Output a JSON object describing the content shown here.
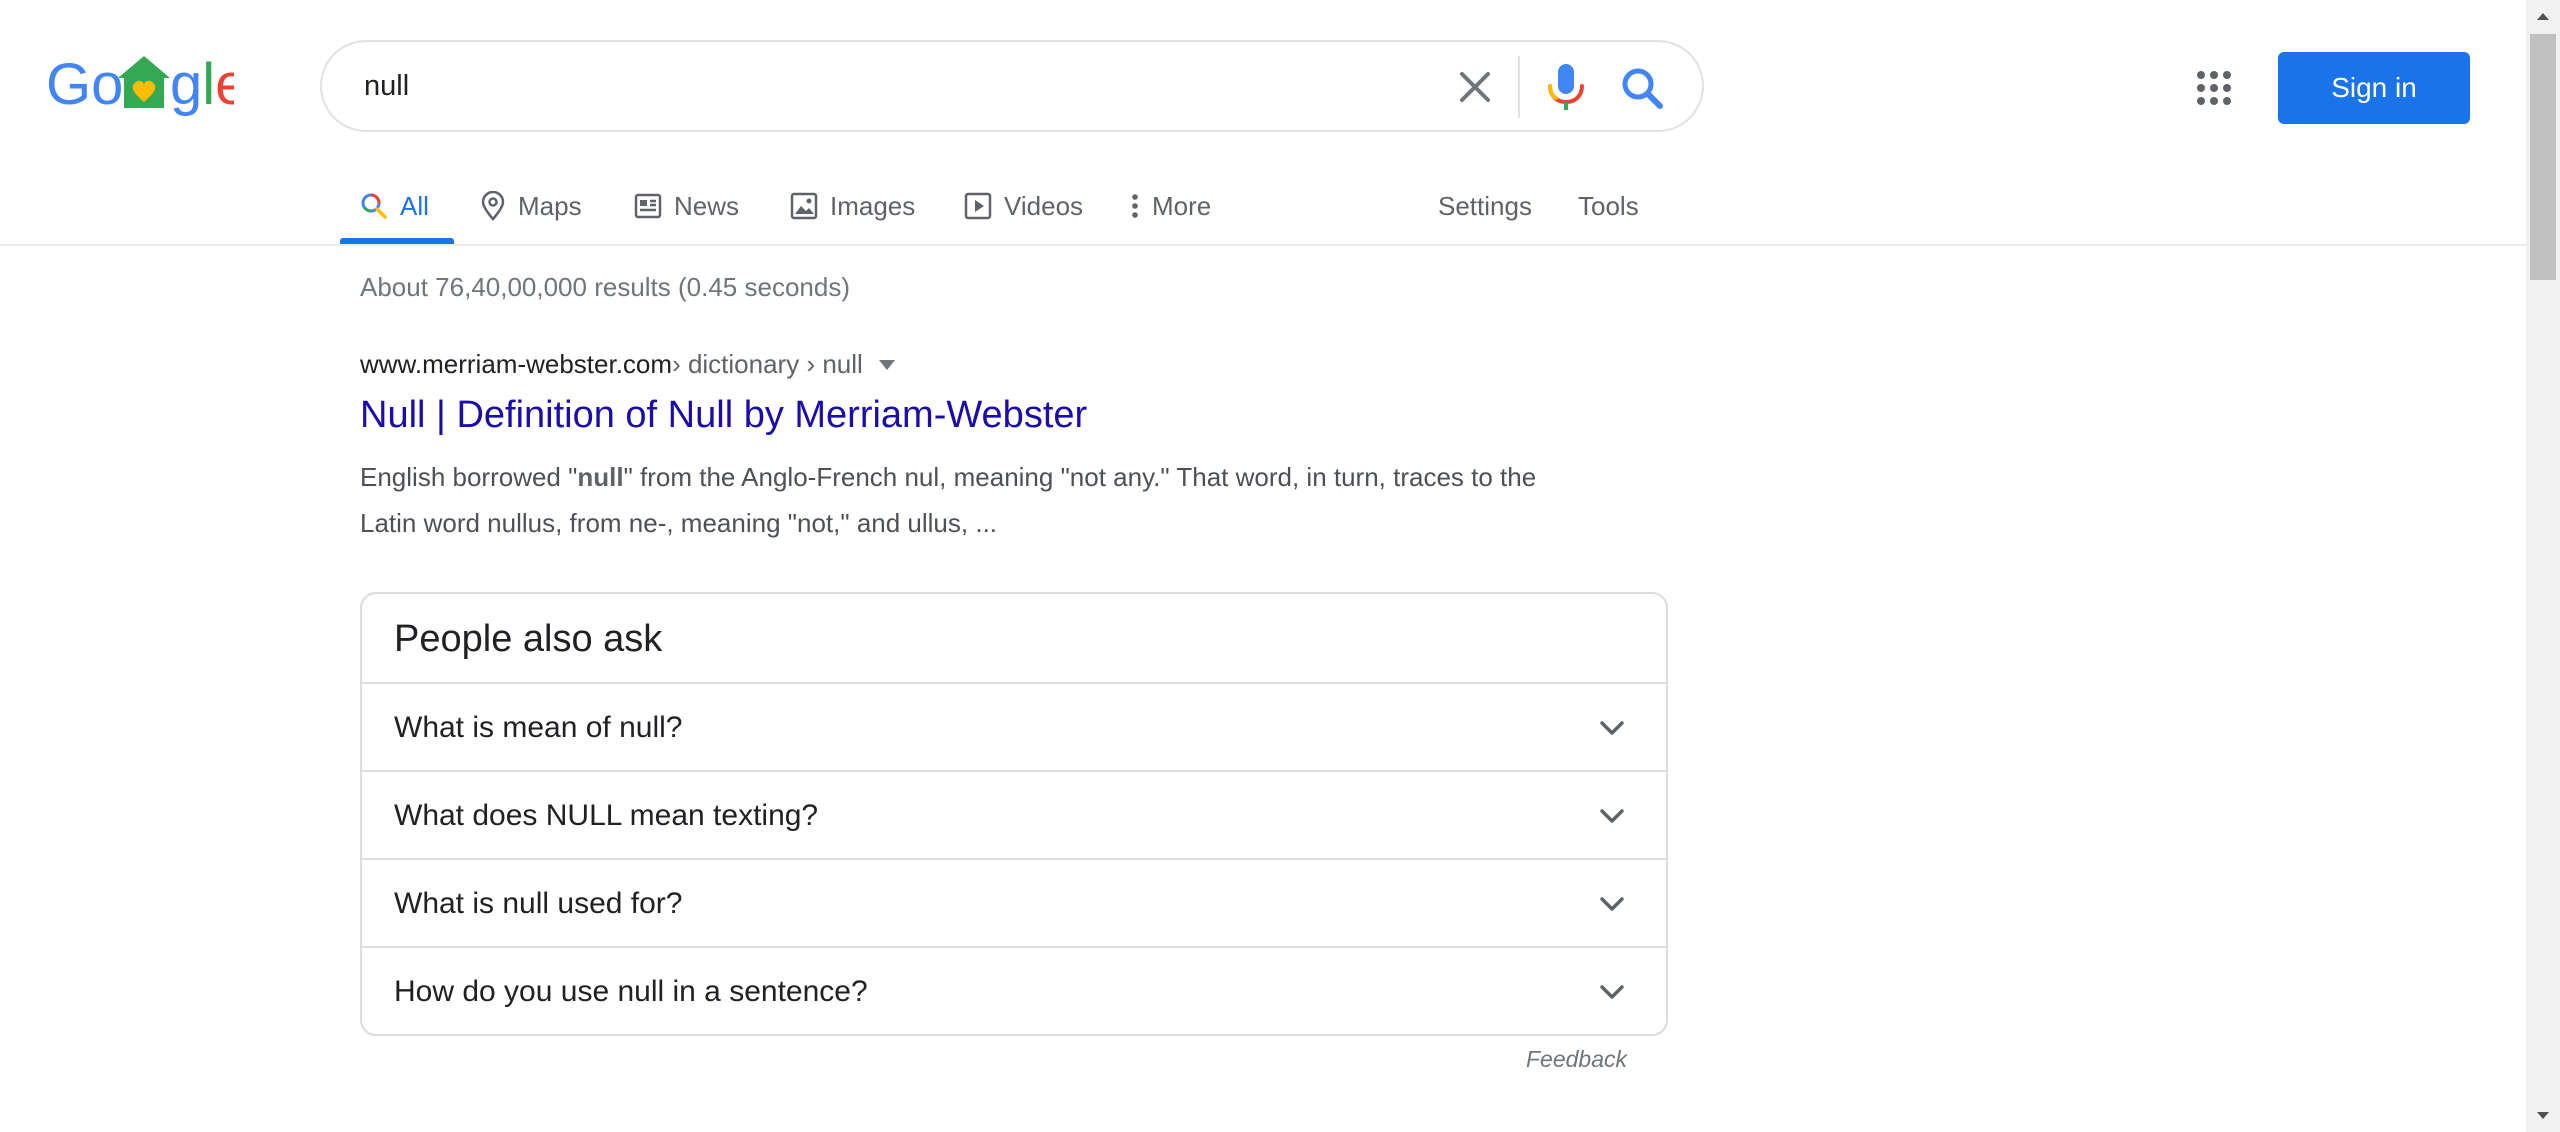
{
  "logo": {
    "text": "Google"
  },
  "search": {
    "query": "null",
    "clear_icon": "close-icon",
    "mic_icon": "microphone-icon",
    "search_icon": "search-icon"
  },
  "header": {
    "apps_icon": "apps-grid-icon",
    "signin_label": "Sign in"
  },
  "tabs": [
    {
      "label": "All",
      "icon": "search-icon",
      "active": true
    },
    {
      "label": "Maps",
      "icon": "map-pin-icon"
    },
    {
      "label": "News",
      "icon": "news-icon"
    },
    {
      "label": "Images",
      "icon": "image-icon"
    },
    {
      "label": "Videos",
      "icon": "play-icon"
    },
    {
      "label": "More",
      "icon": "more-vertical-icon"
    }
  ],
  "tools": {
    "settings": "Settings",
    "tools": "Tools"
  },
  "result_stats": "About 76,40,00,000 results (0.45 seconds)",
  "result": {
    "site": "www.merriam-webster.com",
    "breadcrumb": " › dictionary › null",
    "title": "Null | Definition of Null by Merriam-Webster",
    "snippet_before": "English borrowed \"",
    "snippet_bold": "null",
    "snippet_after": "\" from the Anglo-French nul, meaning \"not any.\" That word, in turn, traces to the Latin word nullus, from ne-, meaning \"not,\" and ullus, ..."
  },
  "people_also_ask": {
    "title": "People also ask",
    "questions": [
      "What is mean of null?",
      "What does NULL mean texting?",
      "What is null used for?",
      "How do you use null in a sentence?"
    ]
  },
  "feedback": "Feedback",
  "colors": {
    "accent": "#1a73e8",
    "link": "#1a0dab",
    "border": "#dadce0"
  }
}
